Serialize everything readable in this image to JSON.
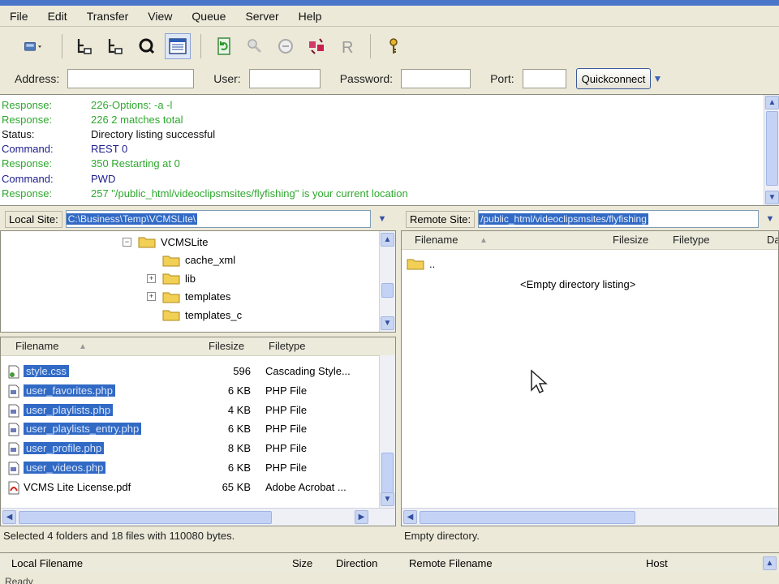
{
  "menu": [
    "File",
    "Edit",
    "Transfer",
    "View",
    "Queue",
    "Server",
    "Help"
  ],
  "quickconnect": {
    "address_label": "Address:",
    "user_label": "User:",
    "password_label": "Password:",
    "port_label": "Port:",
    "button_label": "Quickconnect"
  },
  "log": [
    {
      "type": "Response:",
      "msg": "226-Options: -a -l",
      "kind": "resp"
    },
    {
      "type": "Response:",
      "msg": "226 2 matches total",
      "kind": "resp"
    },
    {
      "type": "Status:",
      "msg": "Directory listing successful",
      "kind": "status"
    },
    {
      "type": "Command:",
      "msg": "REST 0",
      "kind": "cmd"
    },
    {
      "type": "Response:",
      "msg": "350 Restarting at 0",
      "kind": "resp"
    },
    {
      "type": "Command:",
      "msg": "PWD",
      "kind": "cmd"
    },
    {
      "type": "Response:",
      "msg": "257 \"/public_html/videoclipsmsites/flyfishing\" is your current location",
      "kind": "resp"
    }
  ],
  "local": {
    "label": "Local Site:",
    "path": "C:\\Business\\Temp\\VCMSLite\\",
    "tree": [
      {
        "name": "VCMSLite",
        "expander": "−"
      },
      {
        "name": "cache_xml",
        "expander": ""
      },
      {
        "name": "lib",
        "expander": "+"
      },
      {
        "name": "templates",
        "expander": "+"
      },
      {
        "name": "templates_c",
        "expander": ""
      }
    ],
    "columns": {
      "name": "Filename",
      "size": "Filesize",
      "type": "Filetype"
    },
    "files": [
      {
        "name": "style.css",
        "size": "596",
        "type": "Cascading Style...",
        "selected": true,
        "icon": "css"
      },
      {
        "name": "user_favorites.php",
        "size": "6 KB",
        "type": "PHP File",
        "selected": true,
        "icon": "php"
      },
      {
        "name": "user_playlists.php",
        "size": "4 KB",
        "type": "PHP File",
        "selected": true,
        "icon": "php"
      },
      {
        "name": "user_playlists_entry.php",
        "size": "6 KB",
        "type": "PHP File",
        "selected": true,
        "icon": "php"
      },
      {
        "name": "user_profile.php",
        "size": "8 KB",
        "type": "PHP File",
        "selected": true,
        "icon": "php"
      },
      {
        "name": "user_videos.php",
        "size": "6 KB",
        "type": "PHP File",
        "selected": true,
        "icon": "php"
      },
      {
        "name": "VCMS Lite License.pdf",
        "size": "65 KB",
        "type": "Adobe Acrobat ...",
        "selected": false,
        "icon": "pdf"
      }
    ],
    "status": "Selected 4 folders and 18 files with 110080 bytes."
  },
  "remote": {
    "label": "Remote Site:",
    "path": "/public_html/videoclipsmsites/flyfishing",
    "columns": {
      "name": "Filename",
      "size": "Filesize",
      "type": "Filetype",
      "extra": "Da"
    },
    "parent_entry": "..",
    "empty_text": "<Empty directory listing>",
    "status": "Empty directory."
  },
  "queue": {
    "columns": {
      "local": "Local Filename",
      "size": "Size",
      "direction": "Direction",
      "remote": "Remote Filename",
      "host": "Host"
    }
  },
  "bottom_status": "Ready",
  "colors": {
    "selection": "#316ac5",
    "response": "#2ea82e",
    "command": "#1c1c8c",
    "accent": "#4a76c9"
  }
}
